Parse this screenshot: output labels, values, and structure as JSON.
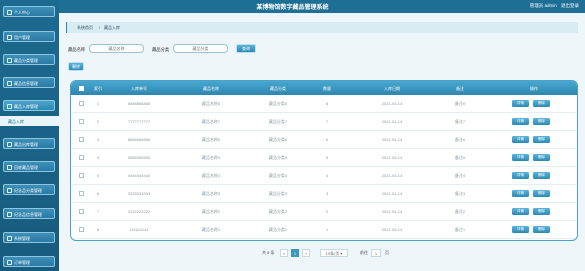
{
  "header": {
    "title": "某博物馆数字藏品管理系统",
    "user": "管理员 admin",
    "logout": "退出登录"
  },
  "sidebar": {
    "items": [
      {
        "label": "个人中心"
      },
      {
        "label": "用户管理"
      },
      {
        "label": "藏品分类管理"
      },
      {
        "label": "藏品信息管理"
      },
      {
        "label": "藏品入库管理"
      },
      {
        "label": "藏品出库管理"
      },
      {
        "label": "回收藏品管理"
      },
      {
        "label": "纪念品分类管理"
      },
      {
        "label": "纪念品信息管理"
      },
      {
        "label": "系统管理"
      },
      {
        "label": "订单管理"
      }
    ],
    "active_sub": "藏品入库"
  },
  "breadcrumb": {
    "home": "系统首页",
    "current": "藏品入库"
  },
  "search": {
    "name_label": "藏品名称",
    "name_placeholder": "藏品名称",
    "type_label": "藏品分类",
    "type_placeholder": "藏品分类",
    "query_button": "查询",
    "delete_button": "删除"
  },
  "table": {
    "columns": [
      "索引",
      "入库单号",
      "藏品名称",
      "藏品分类",
      "数量",
      "入库日期",
      "备注",
      "操作"
    ],
    "edit_label": "详情",
    "delete_label": "删除",
    "rows": [
      {
        "index": "1",
        "no": "8888888888",
        "name": "藏品名称8",
        "type": "藏品分类8",
        "qty": "8",
        "date": "2021-04-14",
        "note": "备注8"
      },
      {
        "index": "2",
        "no": "7777777777",
        "name": "藏品名称7",
        "type": "藏品分类7",
        "qty": "7",
        "date": "2021-04-14",
        "note": "备注7"
      },
      {
        "index": "3",
        "no": "6666666666",
        "name": "藏品名称6",
        "type": "藏品分类6",
        "qty": "6",
        "date": "2021-04-14",
        "note": "备注6"
      },
      {
        "index": "4",
        "no": "5555555555",
        "name": "藏品名称5",
        "type": "藏品分类5",
        "qty": "5",
        "date": "2021-04-14",
        "note": "备注5"
      },
      {
        "index": "5",
        "no": "4444444444",
        "name": "藏品名称4",
        "type": "藏品分类4",
        "qty": "4",
        "date": "2021-04-14",
        "note": "备注4"
      },
      {
        "index": "6",
        "no": "3333333333",
        "name": "藏品名称3",
        "type": "藏品分类3",
        "qty": "3",
        "date": "2021-04-14",
        "note": "备注3"
      },
      {
        "index": "7",
        "no": "2222222222",
        "name": "藏品名称2",
        "type": "藏品分类2",
        "qty": "2",
        "date": "2021-04-14",
        "note": "备注2"
      },
      {
        "index": "8",
        "no": "1111111111",
        "name": "藏品名称1",
        "type": "藏品分类1",
        "qty": "1",
        "date": "2021-04-14",
        "note": "备注1"
      }
    ]
  },
  "pagination": {
    "total": "共 8 条",
    "prev": "<",
    "page": "1",
    "next": ">",
    "page_size": "10条/页",
    "goto_label": "前往",
    "goto_value": "1",
    "goto_suffix": "页"
  }
}
